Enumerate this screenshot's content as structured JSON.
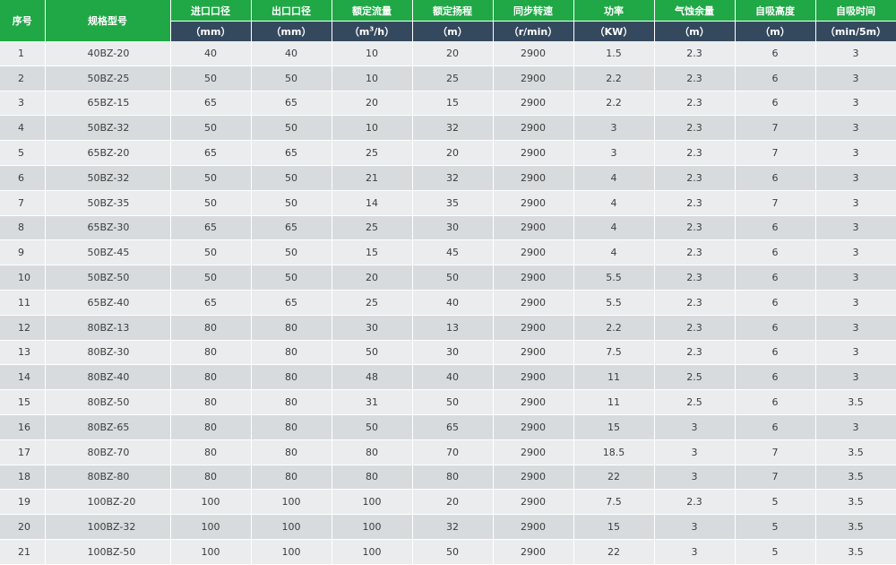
{
  "table": {
    "headers": [
      "序号",
      "规格型号",
      "进口口径",
      "出口口径",
      "额定流量",
      "额定扬程",
      "同步转速",
      "功率",
      "气蚀余量",
      "自吸高度",
      "自吸时间"
    ],
    "units": [
      "",
      "",
      "（mm）",
      "（mm）",
      "",
      "（m）",
      "（r/min）",
      "（KW）",
      "（m）",
      "（m）",
      "（min/5m）"
    ],
    "flow_unit_prefix": "（m",
    "flow_unit_sup": "3",
    "flow_unit_suffix": "/h）",
    "rows": [
      [
        "1",
        "40BZ-20",
        "40",
        "40",
        "10",
        "20",
        "2900",
        "1.5",
        "2.3",
        "6",
        "3"
      ],
      [
        "2",
        "50BZ-25",
        "50",
        "50",
        "10",
        "25",
        "2900",
        "2.2",
        "2.3",
        "6",
        "3"
      ],
      [
        "3",
        "65BZ-15",
        "65",
        "65",
        "20",
        "15",
        "2900",
        "2.2",
        "2.3",
        "6",
        "3"
      ],
      [
        "4",
        "50BZ-32",
        "50",
        "50",
        "10",
        "32",
        "2900",
        "3",
        "2.3",
        "7",
        "3"
      ],
      [
        "5",
        "65BZ-20",
        "65",
        "65",
        "25",
        "20",
        "2900",
        "3",
        "2.3",
        "7",
        "3"
      ],
      [
        "6",
        "50BZ-32",
        "50",
        "50",
        "21",
        "32",
        "2900",
        "4",
        "2.3",
        "6",
        "3"
      ],
      [
        "7",
        "50BZ-35",
        "50",
        "50",
        "14",
        "35",
        "2900",
        "4",
        "2.3",
        "7",
        "3"
      ],
      [
        "8",
        "65BZ-30",
        "65",
        "65",
        "25",
        "30",
        "2900",
        "4",
        "2.3",
        "6",
        "3"
      ],
      [
        "9",
        "50BZ-45",
        "50",
        "50",
        "15",
        "45",
        "2900",
        "4",
        "2.3",
        "6",
        "3"
      ],
      [
        "10",
        "50BZ-50",
        "50",
        "50",
        "20",
        "50",
        "2900",
        "5.5",
        "2.3",
        "6",
        "3"
      ],
      [
        "11",
        "65BZ-40",
        "65",
        "65",
        "25",
        "40",
        "2900",
        "5.5",
        "2.3",
        "6",
        "3"
      ],
      [
        "12",
        "80BZ-13",
        "80",
        "80",
        "30",
        "13",
        "2900",
        "2.2",
        "2.3",
        "6",
        "3"
      ],
      [
        "13",
        "80BZ-30",
        "80",
        "80",
        "50",
        "30",
        "2900",
        "7.5",
        "2.3",
        "6",
        "3"
      ],
      [
        "14",
        "80BZ-40",
        "80",
        "80",
        "48",
        "40",
        "2900",
        "11",
        "2.5",
        "6",
        "3"
      ],
      [
        "15",
        "80BZ-50",
        "80",
        "80",
        "31",
        "50",
        "2900",
        "11",
        "2.5",
        "6",
        "3.5"
      ],
      [
        "16",
        "80BZ-65",
        "80",
        "80",
        "50",
        "65",
        "2900",
        "15",
        "3",
        "6",
        "3"
      ],
      [
        "17",
        "80BZ-70",
        "80",
        "80",
        "80",
        "70",
        "2900",
        "18.5",
        "3",
        "7",
        "3.5"
      ],
      [
        "18",
        "80BZ-80",
        "80",
        "80",
        "80",
        "80",
        "2900",
        "22",
        "3",
        "7",
        "3.5"
      ],
      [
        "19",
        "100BZ-20",
        "100",
        "100",
        "100",
        "20",
        "2900",
        "7.5",
        "2.3",
        "5",
        "3.5"
      ],
      [
        "20",
        "100BZ-32",
        "100",
        "100",
        "100",
        "32",
        "2900",
        "15",
        "3",
        "5",
        "3.5"
      ],
      [
        "21",
        "100BZ-50",
        "100",
        "100",
        "100",
        "50",
        "2900",
        "22",
        "3",
        "5",
        "3.5"
      ]
    ]
  }
}
